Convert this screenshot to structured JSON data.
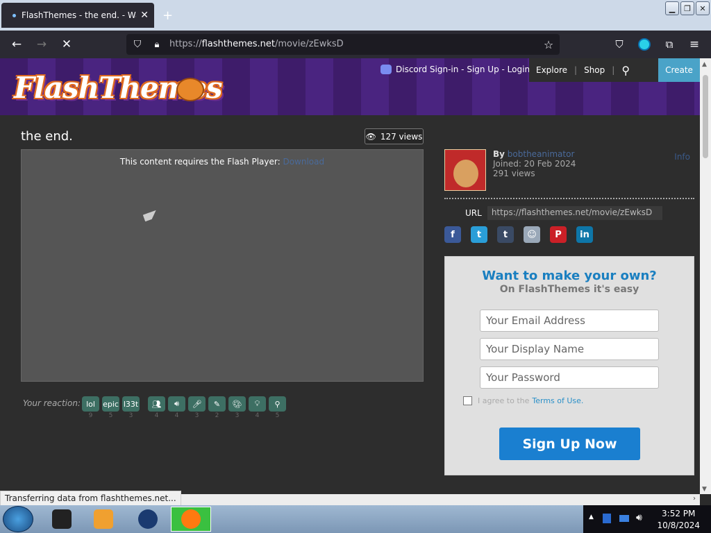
{
  "browser": {
    "tab_title": "FlashThemes - the end. - Watch",
    "url_prefix": "https://",
    "url_host": "flashthemes.net",
    "url_path": "/movie/zEwksD"
  },
  "site": {
    "logo": "FlashThemes",
    "signin": "Discord Sign-in - Sign Up - Login",
    "nav": [
      "Explore",
      "Shop"
    ],
    "create": "Create"
  },
  "movie": {
    "title": "the end.",
    "views": "127 views",
    "flash_required": "This content requires the Flash Player:",
    "flash_link": "Download"
  },
  "reactions": {
    "label": "Your reaction:",
    "items": [
      {
        "label": "lol",
        "count": "9",
        "icon": "text"
      },
      {
        "label": "epic",
        "count": "5",
        "icon": "text"
      },
      {
        "label": "l33t",
        "count": "3",
        "icon": "text"
      },
      {
        "label": "",
        "count": "4",
        "icon": "people-icon"
      },
      {
        "label": "",
        "count": "4",
        "icon": "speaker-icon"
      },
      {
        "label": "",
        "count": "3",
        "icon": "microphone-icon"
      },
      {
        "label": "",
        "count": "2",
        "icon": "brush-icon"
      },
      {
        "label": "",
        "count": "3",
        "icon": "palette-icon"
      },
      {
        "label": "",
        "count": "4",
        "icon": "lightbulb-icon"
      },
      {
        "label": "",
        "count": "5",
        "icon": "stamp-icon"
      }
    ]
  },
  "author": {
    "by_label": "By",
    "name": "bobtheanimator",
    "joined": "Joined: 20 Feb 2024",
    "views": "291 views",
    "info": "Info"
  },
  "share": {
    "url_label": "URL",
    "url_value": "https://flashthemes.net/movie/zEwksD",
    "networks": [
      "facebook",
      "twitter",
      "tumblr",
      "reddit",
      "pinterest",
      "linkedin"
    ]
  },
  "signup": {
    "heading": "Want to make your own?",
    "subheading": "On FlashThemes it's easy",
    "email_placeholder": "Your Email Address",
    "display_placeholder": "Your Display Name",
    "password_placeholder": "Your Password",
    "agree_text": "I agree to the",
    "terms_link": "Terms of Use.",
    "button": "Sign Up Now"
  },
  "statusbar": "Transferring data from flashthemes.net...",
  "taskbar": {
    "time": "3:52 PM",
    "date": "10/8/2024"
  }
}
